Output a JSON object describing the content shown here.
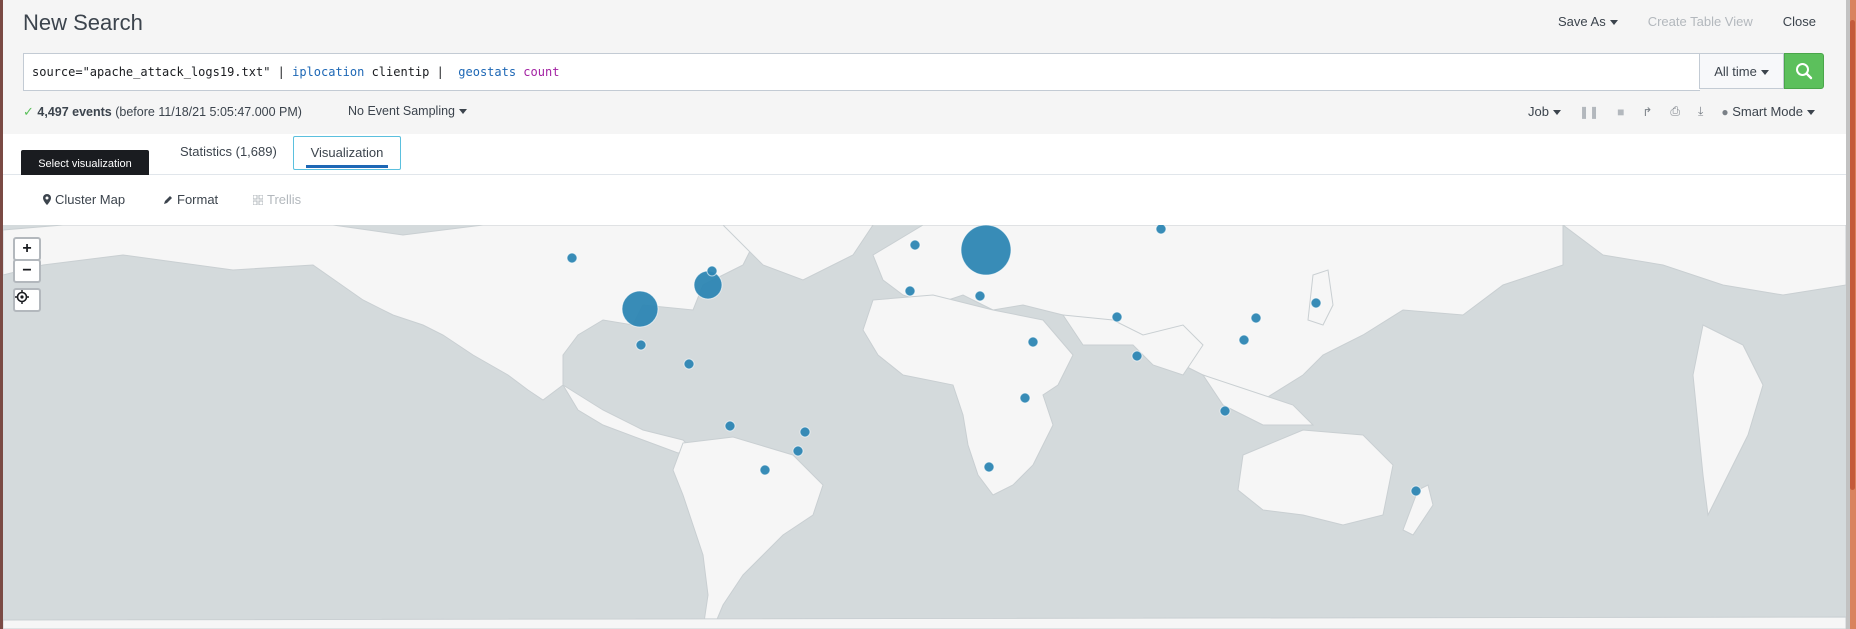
{
  "header": {
    "title": "New Search",
    "actions": [
      {
        "label": "Save As",
        "disabled": false,
        "caret": true
      },
      {
        "label": "Create Table View",
        "disabled": true,
        "caret": false
      },
      {
        "label": "Close",
        "disabled": false,
        "caret": false
      }
    ]
  },
  "search": {
    "query_parts": [
      {
        "text": "source=\"apache_attack_logs19.txt\" | ",
        "kind": "str"
      },
      {
        "text": "iplocation",
        "kind": "cmd"
      },
      {
        "text": " clientip |  ",
        "kind": "str"
      },
      {
        "text": "geostats",
        "kind": "cmd"
      },
      {
        "text": " ",
        "kind": "str"
      },
      {
        "text": "count",
        "kind": "fn"
      }
    ],
    "time_range": "All time",
    "search_button_icon": "search-icon"
  },
  "status": {
    "event_count": "4,497 events",
    "before_text": "(before 11/18/21 5:05:47.000 PM)",
    "sampling": "No Event Sampling",
    "job_label": "Job",
    "mode_label": "Smart Mode"
  },
  "tabs": {
    "statistics": "Statistics (1,689)",
    "visualization": "Visualization"
  },
  "tooltip": "Select visualization",
  "vis_toolbar": {
    "cluster_map": "Cluster Map",
    "format": "Format",
    "trellis": "Trellis"
  },
  "map": {
    "zoom_in": "+",
    "zoom_out": "−",
    "marker_color": "#2d86b3",
    "land_color": "#f6f6f6",
    "water_color": "#d4dadc"
  },
  "colors": {
    "accent_blue": "#1d67b5",
    "search_green": "#5cc05c",
    "tooltip_bg": "#1a1c20"
  }
}
